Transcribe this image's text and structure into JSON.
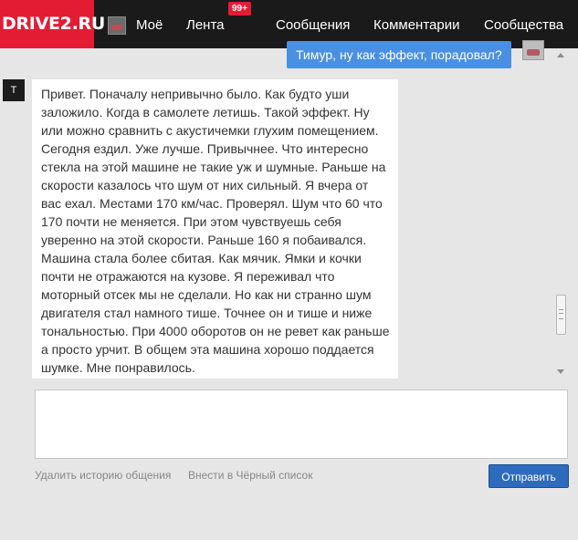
{
  "header": {
    "logo": "DRIVE2.RU",
    "nav": {
      "moe": "Моё",
      "lenta": "Лента",
      "lenta_badge": "99+",
      "messages": "Сообщения",
      "comments": "Комментарии",
      "communities": "Сообщества"
    }
  },
  "conversation": {
    "outgoing": "Тимур, ну как эффект, порадовал?",
    "incoming_avatar_letter": "T",
    "incoming": "Привет. Поначалу непривычно было. Как будто уши заложило. Когда в самолете летишь. Такой эффект. Ну или можно сравнить с акустичемки глухим помещением. Сегодня ездил. Уже лучше. Привычнее. Что интересно стекла на этой машине не такие уж и шумные. Раньше на скорости казалось что шум от них сильный. Я вчера от вас ехал. Местами 170 км/час. Проверял. Шум что 60 что 170 почти не меняется. При этом чувствуешь себя уверенно на этой скорости. Раньше 160 я побаивался. Машина стала более сбитая. Как мячик. Ямки и кочки почти не отражаются на кузове. Я переживал что моторный отсек мы не сделали. Но как ни странно шум двигателя стал намного тише. Точнее он и тише и ниже тональностью. При 4000 оборотов он не ревет как раньше а просто урчит. В общем эта машина хорошо поддается шумке. Мне понравилось."
  },
  "composer": {
    "delete_history": "Удалить историю общения",
    "blacklist": "Внести в Чёрный список",
    "send": "Отправить"
  },
  "colors": {
    "brand": "#e31c34",
    "topbar": "#1a1a1a",
    "outgoing_bubble": "#4a90e2",
    "send_button": "#2f6bbd"
  }
}
